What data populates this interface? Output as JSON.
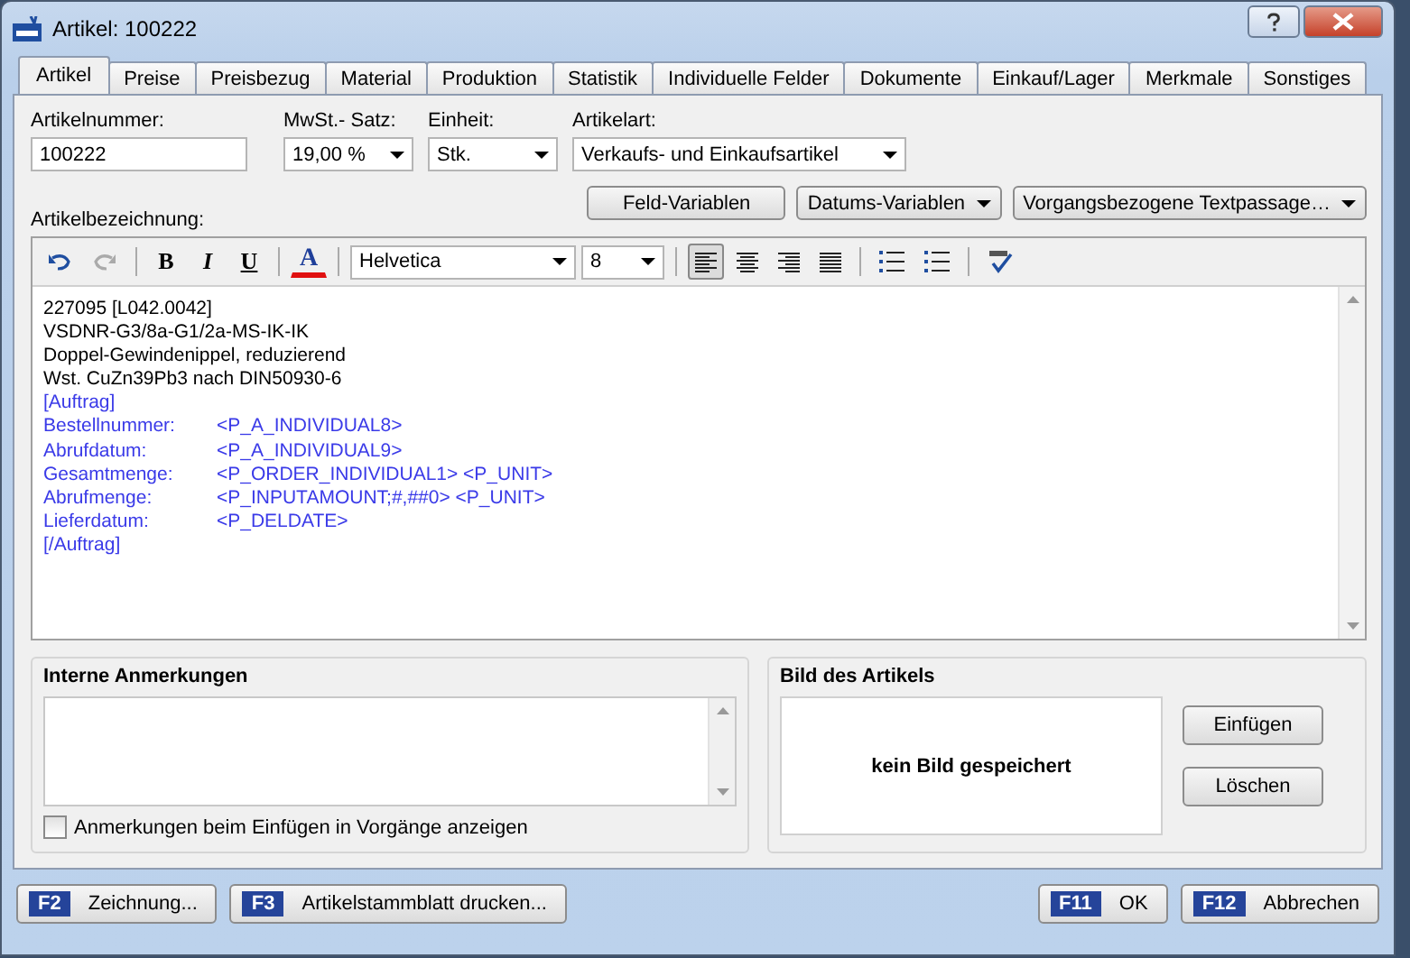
{
  "window": {
    "title": "Artikel: 100222"
  },
  "tabs": [
    {
      "label": "Artikel",
      "selected": true
    },
    {
      "label": "Preise",
      "selected": false
    },
    {
      "label": "Preisbezug",
      "selected": false
    },
    {
      "label": "Material",
      "selected": false
    },
    {
      "label": "Produktion",
      "selected": false
    },
    {
      "label": "Statistik",
      "selected": false
    },
    {
      "label": "Individuelle Felder",
      "selected": false
    },
    {
      "label": "Dokumente",
      "selected": false
    },
    {
      "label": "Einkauf/Lager",
      "selected": false
    },
    {
      "label": "Merkmale",
      "selected": false
    },
    {
      "label": "Sonstiges",
      "selected": false
    }
  ],
  "fields": [
    {
      "label": "Artikelnummer:",
      "value": "100222",
      "kind": "text"
    },
    {
      "label": "MwSt.- Satz:",
      "value": "19,00 %",
      "kind": "select"
    },
    {
      "label": "Einheit:",
      "value": "Stk.",
      "kind": "select"
    },
    {
      "label": "Artikelart:",
      "value": "Verkaufs- und Einkaufsartikel",
      "kind": "select"
    }
  ],
  "description_label": "Artikelbezeichnung:",
  "variable_buttons": [
    {
      "label": "Feld-Variablen",
      "dropdown": false
    },
    {
      "label": "Datums-Variablen",
      "dropdown": true
    },
    {
      "label": "Vorgangsbezogene Textpassage…",
      "dropdown": true
    }
  ],
  "toolbar": [
    {
      "kind": "undo",
      "disabled": false
    },
    {
      "kind": "redo",
      "disabled": true
    },
    {
      "kind": "sep"
    },
    {
      "kind": "bold",
      "text": "B"
    },
    {
      "kind": "italic",
      "text": "I"
    },
    {
      "kind": "underline",
      "text": "U"
    },
    {
      "kind": "sep"
    },
    {
      "kind": "color",
      "text": "A"
    },
    {
      "kind": "sep"
    },
    {
      "kind": "font",
      "value": "Helvetica"
    },
    {
      "kind": "size",
      "value": "8"
    },
    {
      "kind": "sep"
    },
    {
      "kind": "align-left",
      "selected": true
    },
    {
      "kind": "align-center",
      "selected": false
    },
    {
      "kind": "align-right",
      "selected": false
    },
    {
      "kind": "align-justify",
      "selected": false
    },
    {
      "kind": "sep"
    },
    {
      "kind": "bullets"
    },
    {
      "kind": "numbering"
    },
    {
      "kind": "sep"
    },
    {
      "kind": "spellcheck"
    }
  ],
  "editor_lines": [
    {
      "kind": "plain",
      "text": "227095 [L042.0042]"
    },
    {
      "kind": "plain",
      "text": "VSDNR-G3/8a-G1/2a-MS-IK-IK"
    },
    {
      "kind": "plain",
      "text": "Doppel-Gewindenippel, reduzierend"
    },
    {
      "kind": "plain",
      "text": "Wst. CuZn39Pb3 nach DIN50930-6"
    },
    {
      "kind": "tag",
      "text": "[Auftrag]"
    },
    {
      "kind": "field",
      "label": "Bestellnummer:",
      "value": "<P_A_INDIVIDUAL8>"
    },
    {
      "kind": "field",
      "label": "Abrufdatum:",
      "value": "<P_A_INDIVIDUAL9>"
    },
    {
      "kind": "field",
      "label": "Gesamtmenge:",
      "value": "<P_ORDER_INDIVIDUAL1> <P_UNIT>"
    },
    {
      "kind": "field",
      "label": "Abrufmenge:",
      "value": "<P_INPUTAMOUNT;#,##0> <P_UNIT>"
    },
    {
      "kind": "field",
      "label": "Lieferdatum:",
      "value": "<P_DELDATE>"
    },
    {
      "kind": "tag",
      "text": "[/Auftrag]"
    }
  ],
  "notes": {
    "title": "Interne Anmerkungen",
    "checkbox": {
      "label": "Anmerkungen beim Einfügen in Vorgänge anzeigen",
      "checked": false
    }
  },
  "image": {
    "title": "Bild des Artikels",
    "empty_text": "kein Bild gespeichert",
    "buttons": [
      "Einfügen",
      "Löschen"
    ]
  },
  "footer_left": [
    {
      "key": "F2",
      "label": "Zeichnung..."
    },
    {
      "key": "F3",
      "label": "Artikelstammblatt drucken..."
    }
  ],
  "footer_right": [
    {
      "key": "F11",
      "label": "OK"
    },
    {
      "key": "F12",
      "label": "Abbrechen"
    }
  ]
}
